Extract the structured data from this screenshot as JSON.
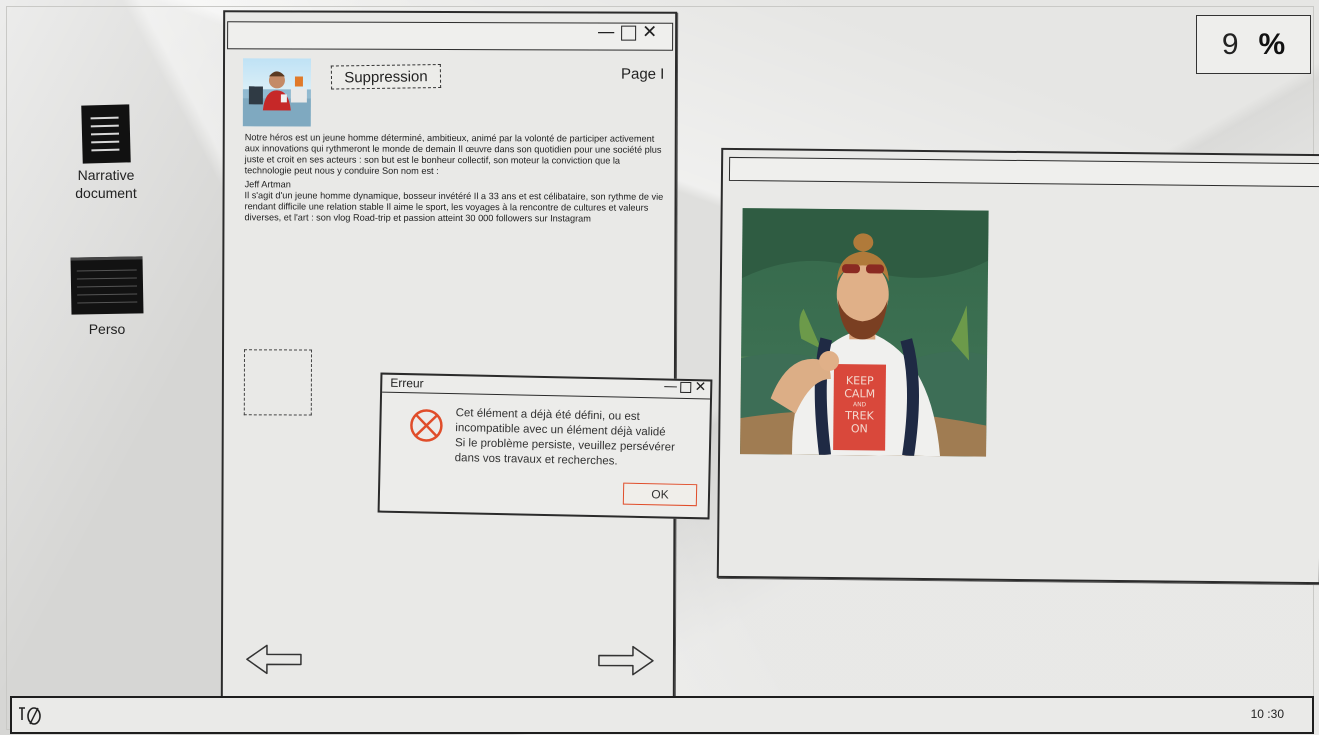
{
  "percent_widget": {
    "value": "9",
    "symbol": "%"
  },
  "desktop_icons": [
    {
      "label": "Narrative document",
      "icon": "document-icon"
    },
    {
      "label": "Perso",
      "icon": "folder-icon"
    }
  ],
  "main_window": {
    "controls": {
      "minimize": "—",
      "close": "✕"
    },
    "suppress_button": "Suppression",
    "page_label": "Page I",
    "paragraph_1": "Notre héros est un jeune homme déterminé, ambitieux, animé par la volonté de participer activement aux innovations qui rythmeront le monde de demain Il œuvre dans son quotidien pour une société plus juste et croit en ses acteurs : son but est le bonheur collectif, son moteur la conviction que la technologie peut nous y conduire Son nom est :",
    "paragraph_2": "Jeff Artman",
    "paragraph_3": "Il s'agit d'un jeune homme dynamique, bosseur invétéré Il a 33 ans et est célibataire, son rythme de vie rendant difficile une relation stable Il aime le sport, les voyages à la rencontre de cultures et valeurs diverses, et l'art : son vlog Road-trip et passion atteint 30 000 followers sur Instagram"
  },
  "error_dialog": {
    "title": "Erreur",
    "controls": {
      "minimize": "—",
      "close": "✕"
    },
    "message_lines": [
      "Cet élément a déjà été défini, ou est",
      "incompatible avec un élément déjà validé",
      "Si le problème persiste, veuillez persévérer",
      "dans vos travaux et recherches."
    ],
    "ok_label": "OK"
  },
  "portrait": {
    "shirt_lines": [
      "KEEP",
      "CALM",
      "AND",
      "TREK",
      "ON"
    ]
  },
  "taskbar": {
    "clock": "10 :30"
  },
  "colors": {
    "accent_orange": "#e04d2a",
    "ink": "#222222",
    "paper": "#e6e6e4"
  }
}
